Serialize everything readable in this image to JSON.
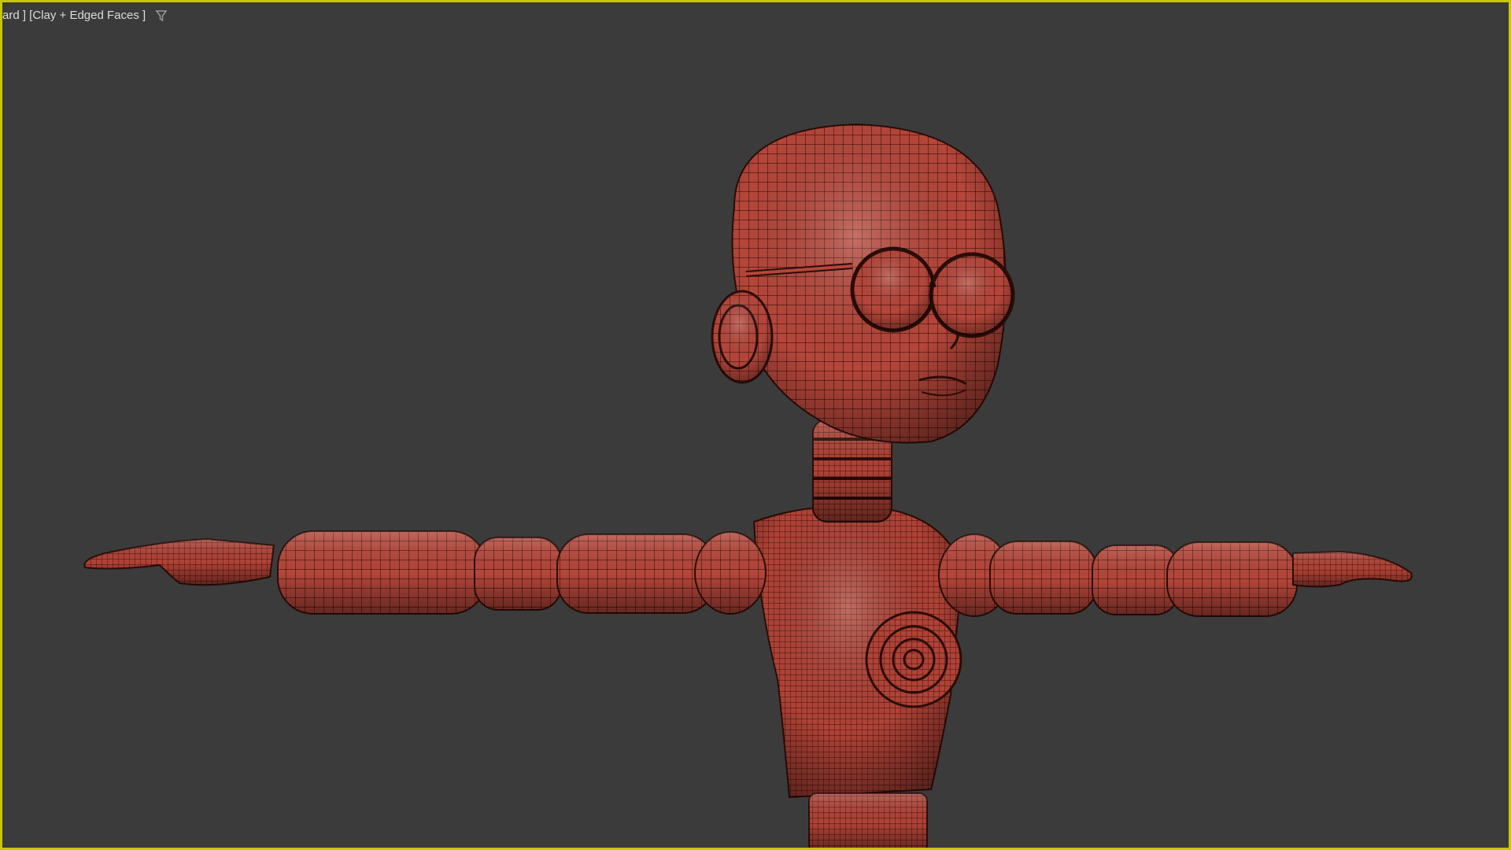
{
  "viewport": {
    "label": "ard ] [Clay + Edged Faces ]",
    "filter_icon": "filter-icon",
    "border_color": "#c8c800",
    "background_color": "#3b3b3b"
  },
  "model": {
    "base_color": "#b5463a",
    "wire_color": "#2a0c08",
    "highlight_color": "#d98a80"
  }
}
